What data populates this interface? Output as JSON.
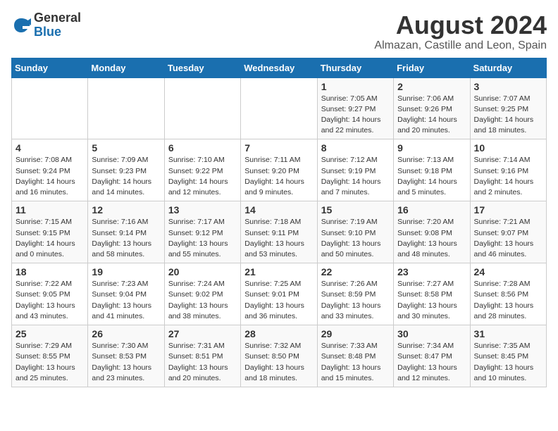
{
  "logo": {
    "general": "General",
    "blue": "Blue"
  },
  "title": "August 2024",
  "subtitle": "Almazan, Castille and Leon, Spain",
  "days_of_week": [
    "Sunday",
    "Monday",
    "Tuesday",
    "Wednesday",
    "Thursday",
    "Friday",
    "Saturday"
  ],
  "weeks": [
    [
      {
        "day": "",
        "info": ""
      },
      {
        "day": "",
        "info": ""
      },
      {
        "day": "",
        "info": ""
      },
      {
        "day": "",
        "info": ""
      },
      {
        "day": "1",
        "info": "Sunrise: 7:05 AM\nSunset: 9:27 PM\nDaylight: 14 hours\nand 22 minutes."
      },
      {
        "day": "2",
        "info": "Sunrise: 7:06 AM\nSunset: 9:26 PM\nDaylight: 14 hours\nand 20 minutes."
      },
      {
        "day": "3",
        "info": "Sunrise: 7:07 AM\nSunset: 9:25 PM\nDaylight: 14 hours\nand 18 minutes."
      }
    ],
    [
      {
        "day": "4",
        "info": "Sunrise: 7:08 AM\nSunset: 9:24 PM\nDaylight: 14 hours\nand 16 minutes."
      },
      {
        "day": "5",
        "info": "Sunrise: 7:09 AM\nSunset: 9:23 PM\nDaylight: 14 hours\nand 14 minutes."
      },
      {
        "day": "6",
        "info": "Sunrise: 7:10 AM\nSunset: 9:22 PM\nDaylight: 14 hours\nand 12 minutes."
      },
      {
        "day": "7",
        "info": "Sunrise: 7:11 AM\nSunset: 9:20 PM\nDaylight: 14 hours\nand 9 minutes."
      },
      {
        "day": "8",
        "info": "Sunrise: 7:12 AM\nSunset: 9:19 PM\nDaylight: 14 hours\nand 7 minutes."
      },
      {
        "day": "9",
        "info": "Sunrise: 7:13 AM\nSunset: 9:18 PM\nDaylight: 14 hours\nand 5 minutes."
      },
      {
        "day": "10",
        "info": "Sunrise: 7:14 AM\nSunset: 9:16 PM\nDaylight: 14 hours\nand 2 minutes."
      }
    ],
    [
      {
        "day": "11",
        "info": "Sunrise: 7:15 AM\nSunset: 9:15 PM\nDaylight: 14 hours\nand 0 minutes."
      },
      {
        "day": "12",
        "info": "Sunrise: 7:16 AM\nSunset: 9:14 PM\nDaylight: 13 hours\nand 58 minutes."
      },
      {
        "day": "13",
        "info": "Sunrise: 7:17 AM\nSunset: 9:12 PM\nDaylight: 13 hours\nand 55 minutes."
      },
      {
        "day": "14",
        "info": "Sunrise: 7:18 AM\nSunset: 9:11 PM\nDaylight: 13 hours\nand 53 minutes."
      },
      {
        "day": "15",
        "info": "Sunrise: 7:19 AM\nSunset: 9:10 PM\nDaylight: 13 hours\nand 50 minutes."
      },
      {
        "day": "16",
        "info": "Sunrise: 7:20 AM\nSunset: 9:08 PM\nDaylight: 13 hours\nand 48 minutes."
      },
      {
        "day": "17",
        "info": "Sunrise: 7:21 AM\nSunset: 9:07 PM\nDaylight: 13 hours\nand 46 minutes."
      }
    ],
    [
      {
        "day": "18",
        "info": "Sunrise: 7:22 AM\nSunset: 9:05 PM\nDaylight: 13 hours\nand 43 minutes."
      },
      {
        "day": "19",
        "info": "Sunrise: 7:23 AM\nSunset: 9:04 PM\nDaylight: 13 hours\nand 41 minutes."
      },
      {
        "day": "20",
        "info": "Sunrise: 7:24 AM\nSunset: 9:02 PM\nDaylight: 13 hours\nand 38 minutes."
      },
      {
        "day": "21",
        "info": "Sunrise: 7:25 AM\nSunset: 9:01 PM\nDaylight: 13 hours\nand 36 minutes."
      },
      {
        "day": "22",
        "info": "Sunrise: 7:26 AM\nSunset: 8:59 PM\nDaylight: 13 hours\nand 33 minutes."
      },
      {
        "day": "23",
        "info": "Sunrise: 7:27 AM\nSunset: 8:58 PM\nDaylight: 13 hours\nand 30 minutes."
      },
      {
        "day": "24",
        "info": "Sunrise: 7:28 AM\nSunset: 8:56 PM\nDaylight: 13 hours\nand 28 minutes."
      }
    ],
    [
      {
        "day": "25",
        "info": "Sunrise: 7:29 AM\nSunset: 8:55 PM\nDaylight: 13 hours\nand 25 minutes."
      },
      {
        "day": "26",
        "info": "Sunrise: 7:30 AM\nSunset: 8:53 PM\nDaylight: 13 hours\nand 23 minutes."
      },
      {
        "day": "27",
        "info": "Sunrise: 7:31 AM\nSunset: 8:51 PM\nDaylight: 13 hours\nand 20 minutes."
      },
      {
        "day": "28",
        "info": "Sunrise: 7:32 AM\nSunset: 8:50 PM\nDaylight: 13 hours\nand 18 minutes."
      },
      {
        "day": "29",
        "info": "Sunrise: 7:33 AM\nSunset: 8:48 PM\nDaylight: 13 hours\nand 15 minutes."
      },
      {
        "day": "30",
        "info": "Sunrise: 7:34 AM\nSunset: 8:47 PM\nDaylight: 13 hours\nand 12 minutes."
      },
      {
        "day": "31",
        "info": "Sunrise: 7:35 AM\nSunset: 8:45 PM\nDaylight: 13 hours\nand 10 minutes."
      }
    ]
  ]
}
